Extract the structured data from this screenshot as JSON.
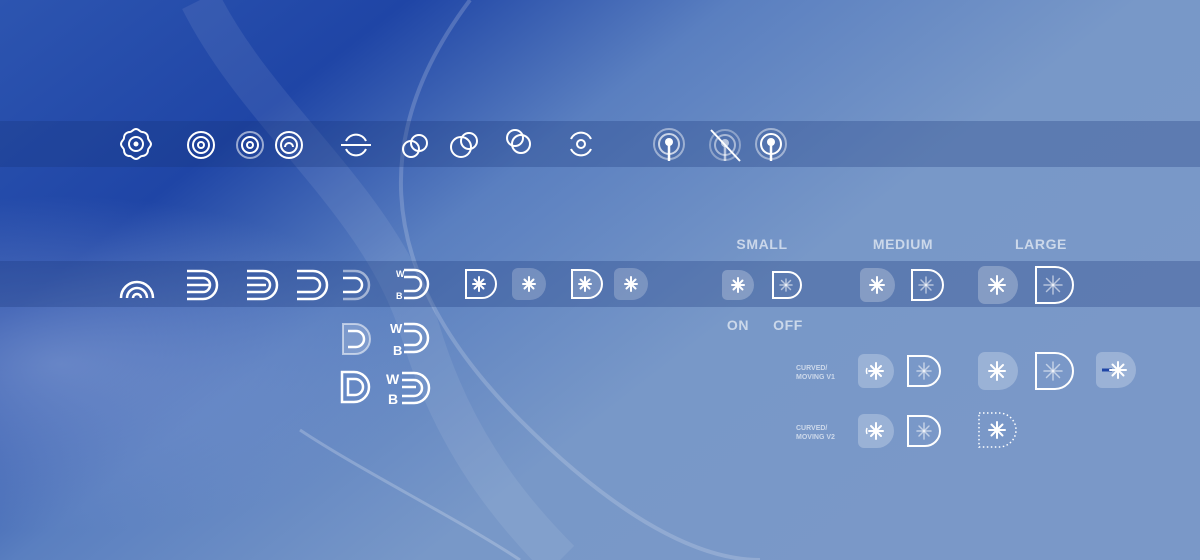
{
  "labels": {
    "small": "SMALL",
    "medium": "MEDIUM",
    "large": "LARGE",
    "on": "ON",
    "off": "OFF",
    "curved_v1": "CURVED/\nMOVING V1",
    "curved_v2": "CURVED/\nMOVING V2"
  },
  "letters": {
    "w": "W",
    "b": "B"
  },
  "colors": {
    "bg_deep": "#1f45a6",
    "bg_light": "#7796c6",
    "icon": "#ffffff",
    "label": "#c9d6ec"
  },
  "icons": [
    "flower-target-icon",
    "concentric-circles-icon",
    "concentric-circles-dim-icon",
    "concentric-arc-icon",
    "split-circle-icon",
    "overlap-circles-icon",
    "signal-pin-icon",
    "signal-pin-off-icon",
    "rainbow-arc-icon",
    "d-stripes-icon",
    "wb-d-icon",
    "asterisk-tile-icon"
  ]
}
